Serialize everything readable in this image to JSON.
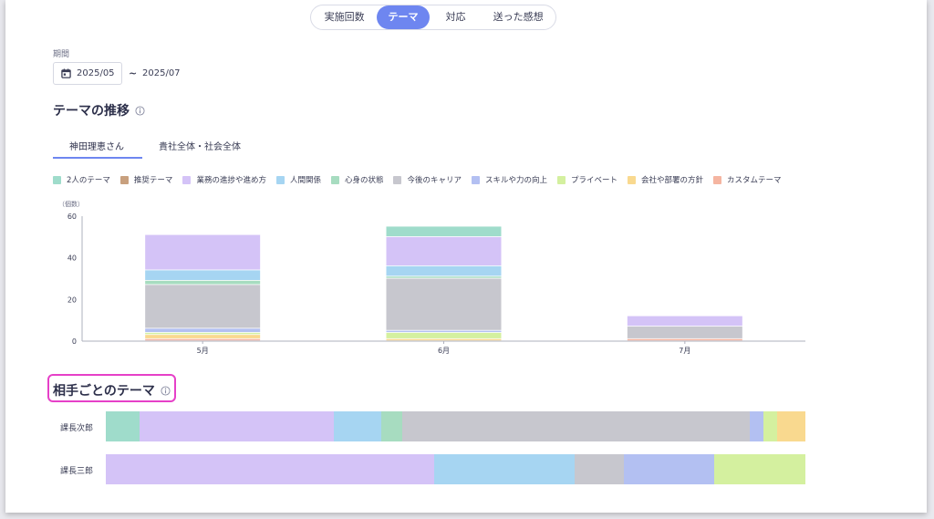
{
  "tabs": [
    {
      "label": "実施回数",
      "active": false
    },
    {
      "label": "テーマ",
      "active": true
    },
    {
      "label": "対応",
      "active": false
    },
    {
      "label": "送った感想",
      "active": false
    }
  ],
  "period": {
    "label": "期間",
    "start": "2025/05",
    "separator": "~",
    "end": "2025/07"
  },
  "section_trend": {
    "title": "テーマの推移",
    "subtabs": [
      {
        "label": "神田理恵さん",
        "active": true
      },
      {
        "label": "貴社全体・社会全体",
        "active": false
      }
    ]
  },
  "section_partner": {
    "title": "相手ごとのテーマ"
  },
  "colors": {
    "accent": "#6e86f0",
    "highlight_border": "#e640c8"
  },
  "chart_data": [
    {
      "type": "bar",
      "stacked": true,
      "ylabel": "（個数）",
      "ylim": [
        0,
        60
      ],
      "yticks": [
        0,
        20,
        40,
        60
      ],
      "categories": [
        "5月",
        "6月",
        "7月"
      ],
      "legend_position": "top",
      "series": [
        {
          "name": "2人のテーマ",
          "color": "#9fdccb",
          "values": [
            0,
            5,
            0
          ]
        },
        {
          "name": "推奨テーマ",
          "color": "#c8a07e",
          "values": [
            0,
            0,
            0
          ]
        },
        {
          "name": "業務の進捗や進め方",
          "color": "#d4c3f7",
          "values": [
            17,
            14,
            5
          ]
        },
        {
          "name": "人間関係",
          "color": "#a6d5f2",
          "values": [
            5,
            5,
            0
          ]
        },
        {
          "name": "心身の状態",
          "color": "#a7dcc0",
          "values": [
            2,
            1,
            0
          ]
        },
        {
          "name": "今後のキャリア",
          "color": "#c7c7ce",
          "values": [
            21,
            25,
            6
          ]
        },
        {
          "name": "スキルや力の向上",
          "color": "#b3c0f2",
          "values": [
            2,
            1,
            0
          ]
        },
        {
          "name": "プライベート",
          "color": "#d4f09f",
          "values": [
            1,
            3,
            0
          ]
        },
        {
          "name": "会社や部署の方針",
          "color": "#f9d98f",
          "values": [
            2,
            1,
            0
          ]
        },
        {
          "name": "カスタムテーマ",
          "color": "#f5b5a1",
          "values": [
            1,
            0,
            1
          ]
        }
      ]
    },
    {
      "type": "bar",
      "orientation": "horizontal",
      "stacked": true,
      "normalized": true,
      "categories": [
        "課長次郎",
        "課長三郎"
      ],
      "series": [
        {
          "name": "2人のテーマ",
          "color": "#9fdccb",
          "values": [
            4.8,
            0
          ]
        },
        {
          "name": "業務の進捗や進め方",
          "color": "#d4c3f7",
          "values": [
            27.8,
            47
          ]
        },
        {
          "name": "人間関係",
          "color": "#a6d5f2",
          "values": [
            6.8,
            20
          ]
        },
        {
          "name": "心身の状態",
          "color": "#a7dcc0",
          "values": [
            3,
            0
          ]
        },
        {
          "name": "今後のキャリア",
          "color": "#c7c7ce",
          "values": [
            49.6,
            7
          ]
        },
        {
          "name": "スキルや力の向上",
          "color": "#b3c0f2",
          "values": [
            2,
            13
          ]
        },
        {
          "name": "プライベート",
          "color": "#d4f09f",
          "values": [
            2,
            13
          ]
        },
        {
          "name": "会社や部署の方針",
          "color": "#f9d98f",
          "values": [
            4,
            0
          ]
        }
      ]
    }
  ]
}
